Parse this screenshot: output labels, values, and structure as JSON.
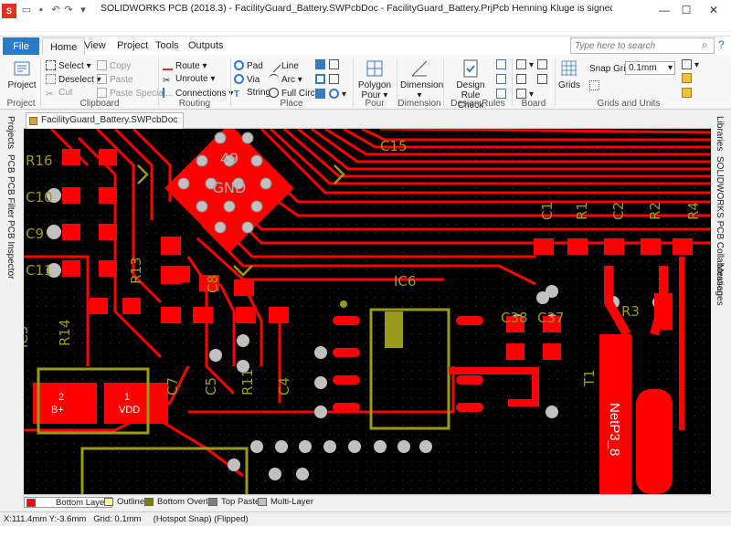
{
  "window": {
    "title": "SOLIDWORKS PCB (2018.3) - FacilityGuard_Battery.SWPcbDoc - FacilityGuard_Battery.PrjPcb Henning Kluge is signed in SOLIDWORKS PCB Services.",
    "logo_text": "S",
    "min_label": "—",
    "max_label": "☐",
    "close_label": "✕"
  },
  "tabs": {
    "file": "File",
    "home": "Home",
    "view": "View",
    "project": "Project",
    "tools": "Tools",
    "outputs": "Outputs"
  },
  "search": {
    "placeholder": "Type here to search"
  },
  "ribbon": {
    "project": {
      "button": "Project",
      "group": "Project"
    },
    "clipboard": {
      "select": "Select",
      "deselect": "Deselect",
      "cut": "Cut",
      "copy": "Copy",
      "paste": "Paste",
      "paste_special": "Paste Special...",
      "group": "Clipboard"
    },
    "routing": {
      "route": "Route",
      "unroute": "Unroute",
      "connections": "Connections",
      "group": "Routing"
    },
    "place": {
      "pad": "Pad",
      "via": "Via",
      "string": "String",
      "line": "Line",
      "arc": "Arc",
      "full_circle": "Full Circle",
      "group": "Place"
    },
    "pour": {
      "button": "Polygon Pour",
      "group": "Pour"
    },
    "dimension": {
      "button": "Dimension",
      "group": "Dimension"
    },
    "design_rules": {
      "button": "Design Rule Check",
      "group": "Design Rules"
    },
    "board": {
      "group": "Board"
    },
    "grids": {
      "button": "Grids",
      "snap_label": "Snap Grid",
      "snap_value": "0.1mm",
      "group": "Grids and Units"
    }
  },
  "document": {
    "tab": "FacilityGuard_Battery.SWPcbDoc"
  },
  "left_panels": [
    "Projects",
    "PCB",
    "PCB Filter",
    "PCB Inspector"
  ],
  "right_panels": [
    "Libraries",
    "SOLIDWORKS PCB Collaboration",
    "Messages"
  ],
  "pcb": {
    "designators": [
      "R16",
      "C10",
      "C9",
      "C11",
      "C15",
      "R13",
      "C8",
      "R14",
      "IC5",
      "IC6",
      "C38",
      "C37",
      "C1",
      "R1",
      "C2",
      "R2",
      "R4",
      "R3",
      "T1",
      "C7",
      "C5",
      "R11",
      "C4",
      "NetP3_8"
    ],
    "chip_label": "49\nGND",
    "pad_labels": {
      "b_plus_num": "2",
      "b_plus": "B+",
      "vdd_num": "1",
      "vdd": "VDD"
    },
    "colors": {
      "bottom_layer": "#ff0000",
      "overlay": "#9a9a1a",
      "background": "#000000",
      "pads": "#c0c0c0"
    }
  },
  "layers": [
    {
      "name": "Bottom Layer",
      "color": "#ff0000",
      "active": true
    },
    {
      "name": "Outline",
      "color": "#ffffa0",
      "active": false
    },
    {
      "name": "Bottom Overlay",
      "color": "#808000",
      "active": false
    },
    {
      "name": "Top Paste",
      "color": "#808080",
      "active": false
    },
    {
      "name": "Multi-Layer",
      "color": "#c0c0c0",
      "active": false
    }
  ],
  "status": {
    "text": "X:111.4mm Y:-3.6mm   Grid: 0.1mm     (Hotspot Snap) (Flipped)"
  }
}
